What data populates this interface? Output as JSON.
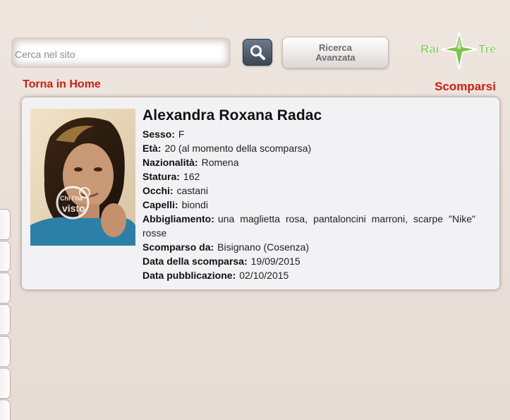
{
  "search": {
    "placeholder": "Cerca nel sito",
    "value": ""
  },
  "search_button": {
    "icon": "search-icon"
  },
  "advanced_search": {
    "line1": "Ricerca",
    "line2": "Avanzata"
  },
  "logo": {
    "left": "Rai",
    "right": "Tre"
  },
  "nav": {
    "home_link": "Torna in Home",
    "section_title": "Scomparsi"
  },
  "person": {
    "name": "Alexandra Roxana Radac",
    "photo_watermark": {
      "line1": "Chi l'ha",
      "line2": "visto"
    },
    "fields": [
      {
        "label": "Sesso:",
        "value": "F"
      },
      {
        "label": "Età:",
        "value": "20 (al momento della scomparsa)"
      },
      {
        "label": "Nazionalità:",
        "value": "Romena"
      },
      {
        "label": "Statura:",
        "value": "162"
      },
      {
        "label": "Occhi:",
        "value": "castani"
      },
      {
        "label": "Capelli:",
        "value": "biondi"
      },
      {
        "label": "Abbigliamento:",
        "value": "una maglietta rosa, pantaloncini marroni, scarpe \"Nike\" rosse"
      },
      {
        "label": "Scomparso da:",
        "value": "Bisignano (Cosenza)"
      },
      {
        "label": "Data della scomparsa:",
        "value": "19/09/2015"
      },
      {
        "label": "Data pubblicazione:",
        "value": "02/10/2015"
      }
    ]
  },
  "colors": {
    "accent_red": "#d21c10",
    "logo_green": "#7ec34a"
  }
}
